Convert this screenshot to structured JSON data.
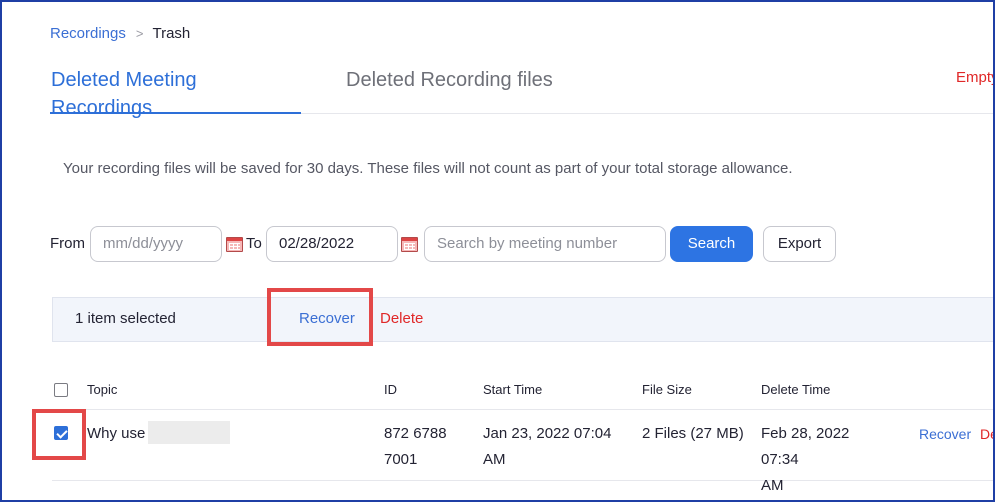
{
  "breadcrumb": {
    "parent": "Recordings",
    "separator": ">",
    "current": "Trash"
  },
  "tabs": [
    {
      "label": "Deleted Meeting Recordings",
      "active": true
    },
    {
      "label": "Deleted Recording files",
      "active": false
    }
  ],
  "header_actions": {
    "empty_trash": "Empty"
  },
  "notice": "Your recording files will be saved for 30 days. These files will not count as part of your total storage allowance.",
  "filters": {
    "from_label": "From",
    "from_placeholder": "mm/dd/yyyy",
    "to_label": "To",
    "to_value": "02/28/2022",
    "search_placeholder": "Search by meeting number",
    "search_button": "Search",
    "export_button": "Export",
    "calendar_icon": "calendar-icon"
  },
  "selection_bar": {
    "count_text": "1 item selected",
    "recover": "Recover",
    "delete": "Delete"
  },
  "table": {
    "columns": [
      "Topic",
      "ID",
      "Start Time",
      "File Size",
      "Delete Time"
    ],
    "rows": [
      {
        "selected": true,
        "topic": "Why use",
        "id_line1": "872 6788",
        "id_line2": "7001",
        "start_line1": "Jan 23, 2022 07:04",
        "start_line2": "AM",
        "file_size": "2 Files (27 MB)",
        "delete_line1": "Feb 28, 2022 07:34",
        "delete_line2": "AM",
        "action_recover": "Recover",
        "action_delete": "De"
      }
    ]
  },
  "colors": {
    "accent": "#2d6fd8",
    "danger": "#e02828",
    "highlight": "#e34848"
  }
}
